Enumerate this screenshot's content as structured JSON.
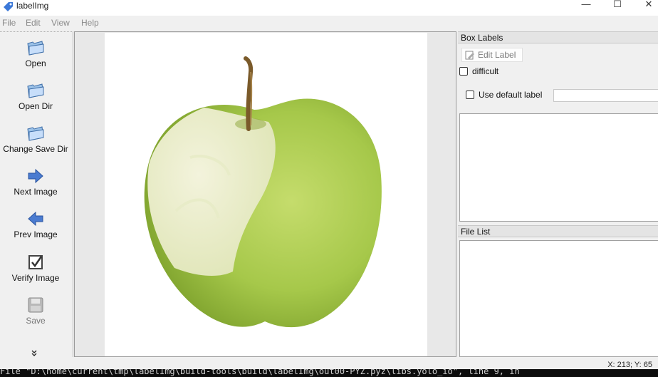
{
  "window": {
    "title": "labelImg",
    "minimize": "—",
    "maximize": "☐",
    "close": "✕"
  },
  "menu": [
    {
      "label": "File"
    },
    {
      "label": "Edit"
    },
    {
      "label": "View"
    },
    {
      "label": "Help"
    }
  ],
  "toolbar": {
    "open": "Open",
    "open_dir": "Open Dir",
    "change_save_dir": "Change Save Dir",
    "next_image": "Next Image",
    "prev_image": "Prev Image",
    "verify_image": "Verify Image",
    "save": "Save",
    "more": "»"
  },
  "box_labels": {
    "title": "Box Labels",
    "edit_label": "Edit Label",
    "difficult": "difficult",
    "use_default_label": "Use default label",
    "default_label_value": ""
  },
  "file_list": {
    "title": "File List"
  },
  "status": {
    "coords": "X: 213; Y: 65"
  },
  "terminal": {
    "line": "File \"D:\\home\\current\\tmp\\labelImg\\build-tools\\build\\labelImg\\out00-PYZ.pyz\\libs.yolo_io\", line 9, in"
  },
  "colors": {
    "apple_light": "#cfe08a",
    "apple_dark": "#8fb433",
    "bite": "#eef0d8",
    "stem": "#7a5a2a",
    "arrow_blue": "#3d6fc4"
  }
}
